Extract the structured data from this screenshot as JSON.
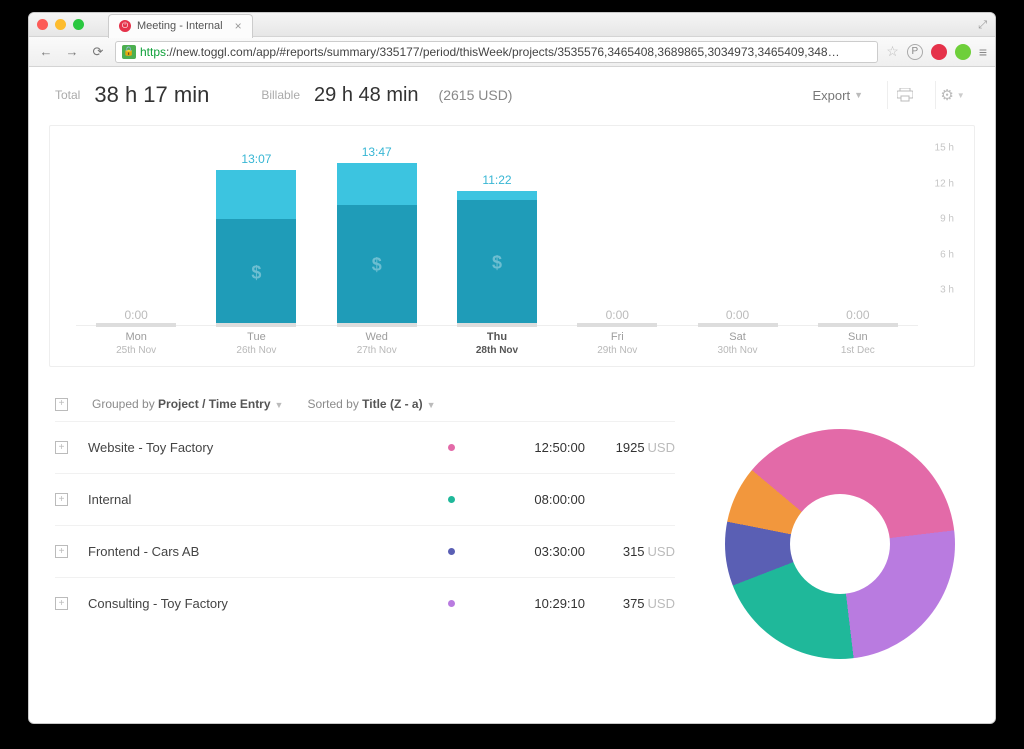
{
  "browser": {
    "tab_title": "Meeting - Internal",
    "url_scheme": "https",
    "url_rest": "://new.toggl.com/app/#reports/summary/335177/period/thisWeek/projects/3535576,3465408,3689865,3034973,3465409,348…"
  },
  "summary": {
    "total_label": "Total",
    "total_value": "38 h 17 min",
    "billable_label": "Billable",
    "billable_value": "29 h 48 min",
    "billable_amount": "(2615 USD)",
    "export_label": "Export"
  },
  "chart_data": {
    "type": "bar",
    "ylabel": "hours",
    "ylim": [
      0,
      15
    ],
    "yticks": [
      "3 h",
      "6 h",
      "9 h",
      "12 h",
      "15 h"
    ],
    "days": [
      {
        "dow": "Mon",
        "date": "25th Nov",
        "label": "0:00",
        "total_h": 0,
        "billable_h": 0,
        "today": false
      },
      {
        "dow": "Tue",
        "date": "26th Nov",
        "label": "13:07",
        "total_h": 13.12,
        "billable_h": 9.0,
        "today": false
      },
      {
        "dow": "Wed",
        "date": "27th Nov",
        "label": "13:47",
        "total_h": 13.78,
        "billable_h": 10.2,
        "today": false
      },
      {
        "dow": "Thu",
        "date": "28th Nov",
        "label": "11:22",
        "total_h": 11.37,
        "billable_h": 10.6,
        "today": true
      },
      {
        "dow": "Fri",
        "date": "29th Nov",
        "label": "0:00",
        "total_h": 0,
        "billable_h": 0,
        "today": false
      },
      {
        "dow": "Sat",
        "date": "30th Nov",
        "label": "0:00",
        "total_h": 0,
        "billable_h": 0,
        "today": false
      },
      {
        "dow": "Sun",
        "date": "1st Dec",
        "label": "0:00",
        "total_h": 0,
        "billable_h": 0,
        "today": false
      }
    ]
  },
  "controls": {
    "grouped_prefix": "Grouped by ",
    "grouped_value": "Project / Time Entry",
    "sorted_prefix": "Sorted by ",
    "sorted_value": "Title (Z - a)"
  },
  "projects": [
    {
      "name": "Website - Toy Factory",
      "color": "#e36aa8",
      "time": "12:50:00",
      "amount": "1925",
      "currency": "USD"
    },
    {
      "name": "Internal",
      "color": "#1fb89a",
      "time": "08:00:00",
      "amount": "",
      "currency": ""
    },
    {
      "name": "Frontend - Cars AB",
      "color": "#5a5fb4",
      "time": "03:30:00",
      "amount": "315",
      "currency": "USD"
    },
    {
      "name": "Consulting - Toy Factory",
      "color": "#b97be0",
      "time": "10:29:10",
      "amount": "375",
      "currency": "USD"
    }
  ],
  "donut": {
    "slices": [
      {
        "color": "#e36aa8",
        "pct": 37
      },
      {
        "color": "#b97be0",
        "pct": 25
      },
      {
        "color": "#1fb89a",
        "pct": 21
      },
      {
        "color": "#5a5fb4",
        "pct": 9
      },
      {
        "color": "#f2973d",
        "pct": 8
      }
    ]
  }
}
